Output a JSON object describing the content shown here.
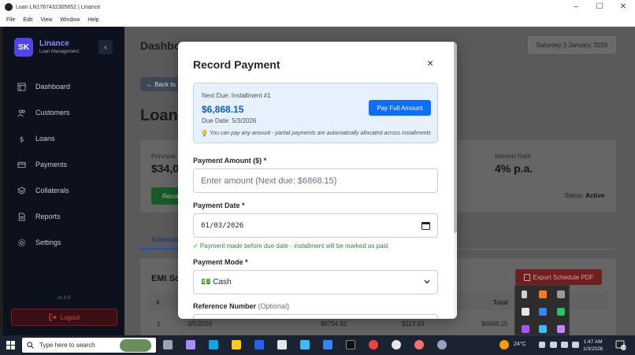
{
  "window": {
    "title": "Loan LN1767432305652 | Linance",
    "controls": [
      "–",
      "☐",
      "✕"
    ]
  },
  "menu": [
    "File",
    "Edit",
    "View",
    "Window",
    "Help"
  ],
  "sidebar": {
    "logo_initials": "SK",
    "brand": "Linance",
    "subtitle": "Loan Management",
    "collapse": "‹",
    "items": [
      {
        "label": "Dashboard",
        "icon": "dashboard-icon"
      },
      {
        "label": "Customers",
        "icon": "users-icon"
      },
      {
        "label": "Loans",
        "icon": "dollar-icon"
      },
      {
        "label": "Payments",
        "icon": "card-icon"
      },
      {
        "label": "Collaterals",
        "icon": "layers-icon"
      },
      {
        "label": "Reports",
        "icon": "document-icon"
      },
      {
        "label": "Settings",
        "icon": "gear-icon"
      }
    ],
    "version": "v1.0.0",
    "logout": "Logout"
  },
  "main": {
    "title": "Dashboard",
    "date": "Saturday 3 January, 2026",
    "back": "← Back to",
    "loan_title": "Loan",
    "principal_label": "Principal",
    "principal_value": "$34,0",
    "rate_label": "Interest Rate",
    "rate_value": "4% p.a.",
    "record_btn": "Record",
    "status_label": "Status:",
    "status_value": "Active",
    "tab": "Schedule",
    "emi_title": "EMI Sc",
    "export": "Export Schedule PDF",
    "table": {
      "hash": "#",
      "total": "Total",
      "row": [
        "1",
        "3/5/2026",
        "$6754.82",
        "$113.33",
        "$6868.15"
      ]
    }
  },
  "modal": {
    "title": "Record Payment",
    "close": "×",
    "next_due_label": "Next Due: Installment #1",
    "next_due_amount": "$6,868.15",
    "due_date": "Due Date: 5/3/2026",
    "hint": "You can pay any amount - partial payments are automatically allocated across installments",
    "pay_full": "Pay Full Amount",
    "amount_label": "Payment Amount ($) *",
    "amount_placeholder": "Enter amount (Next due: $6868.15)",
    "date_label": "Payment Date *",
    "date_value": "01/03/2026",
    "date_note": "✓ Payment made before due date - installment will be marked as paid",
    "mode_label": "Payment Mode *",
    "mode_value": "💵 Cash",
    "ref_label": "Reference Number",
    "ref_optional": "(Optional)"
  },
  "taskbar": {
    "search_placeholder": "Type here to search",
    "temperature": "24°C",
    "time": "1:47 AM",
    "date": "1/3/2026",
    "notifications": "19"
  }
}
